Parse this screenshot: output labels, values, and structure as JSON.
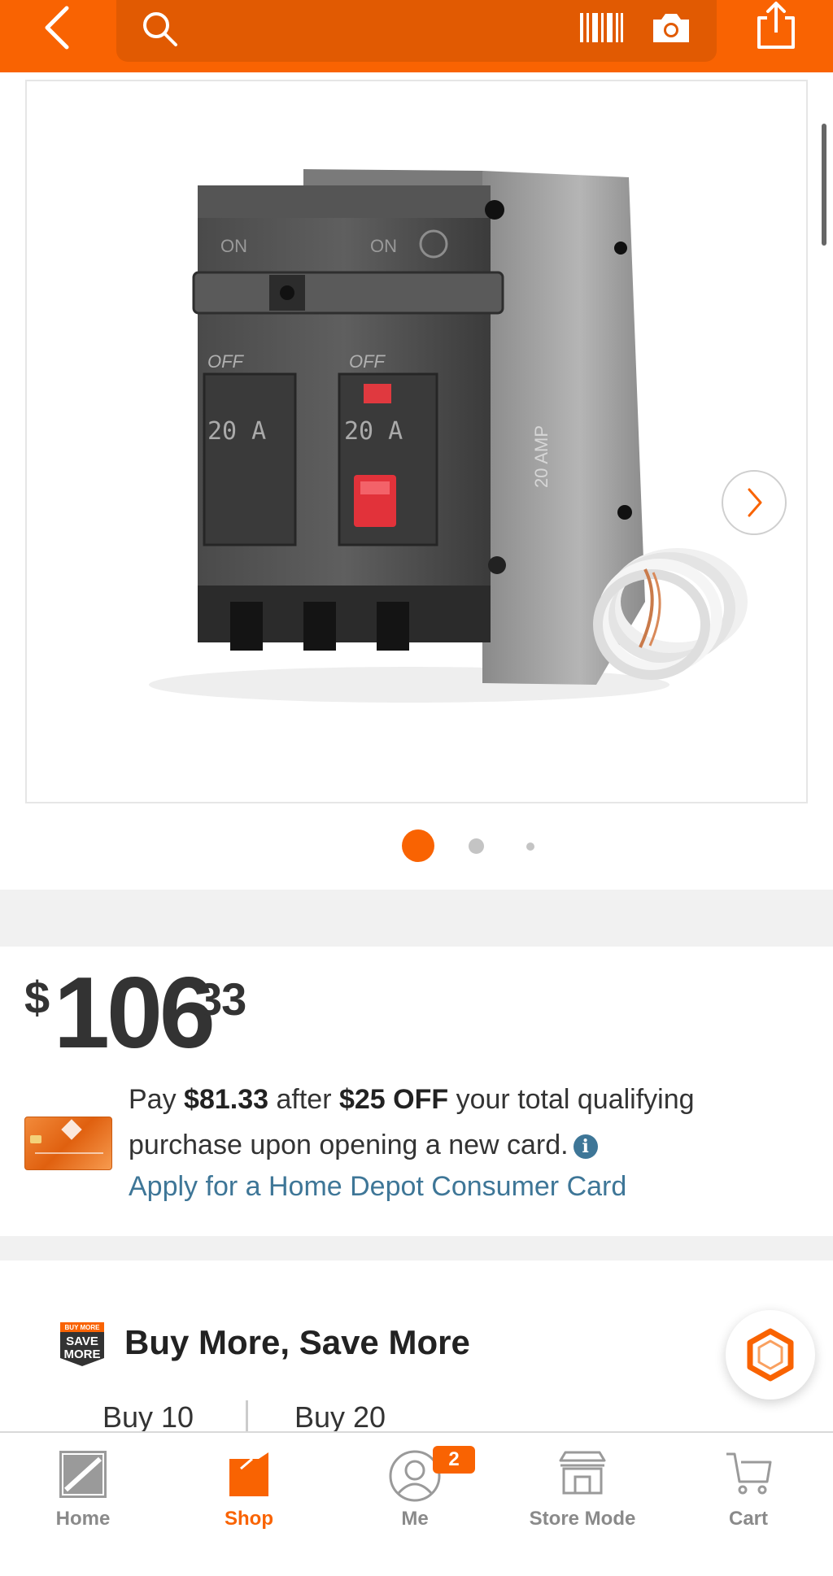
{
  "header": {
    "back_icon": "chevron-left-icon",
    "search_icon": "search-icon",
    "barcode_icon": "barcode-scan-icon",
    "camera_icon": "camera-icon",
    "share_icon": "share-icon",
    "brand_color": "#f96302"
  },
  "gallery": {
    "image_subject": "GE 20 Amp 2-pole ground fault circuit breaker",
    "image_labels": {
      "left_on": "ON",
      "right_on": "ON",
      "left_off": "OFF",
      "right_off": "OFF",
      "left_amp": "20 A",
      "right_amp": "20 A",
      "side_text": "20 AMP"
    },
    "next_icon": "chevron-right-icon",
    "total_images": 3,
    "active_image": 1
  },
  "price": {
    "currency": "$",
    "whole": "106",
    "cents": "33"
  },
  "promo": {
    "text_pay": "Pay ",
    "discounted_price": "$81.33",
    "text_after": " after ",
    "discount": "$25 OFF",
    "text_rest": " your total qualifying purchase upon opening a new card.",
    "info_icon": "i",
    "apply_link": "Apply for a Home Depot Consumer Card",
    "card_icon": "credit-card-icon"
  },
  "buy_more": {
    "badge_lines": [
      "BUY MORE",
      "SAVE",
      "MORE"
    ],
    "title": "Buy More, Save More",
    "tiers": [
      "Buy 10",
      "Buy 20"
    ]
  },
  "chat_icon": "chat-hexagon-icon",
  "bottom_nav": {
    "items": [
      {
        "label": "Home",
        "icon": "home-depot-logo-icon",
        "active": false
      },
      {
        "label": "Shop",
        "icon": "shop-bag-icon",
        "active": true
      },
      {
        "label": "Me",
        "icon": "user-icon",
        "active": false,
        "badge": "2"
      },
      {
        "label": "Store Mode",
        "icon": "store-icon",
        "active": false
      },
      {
        "label": "Cart",
        "icon": "cart-icon",
        "active": false
      }
    ]
  }
}
